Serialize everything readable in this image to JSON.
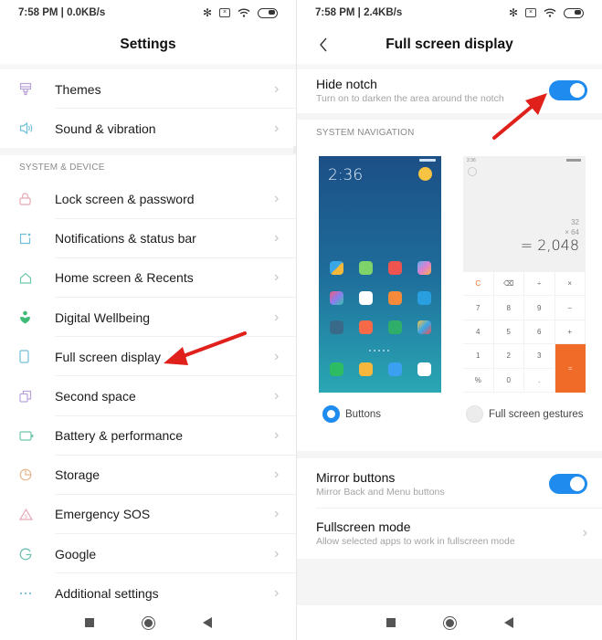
{
  "left": {
    "status": {
      "time_speed": "7:58 PM | 0.0KB/s",
      "icons": [
        "bluetooth-icon",
        "sim-icon",
        "wifi-icon",
        "battery-icon"
      ]
    },
    "title": "Settings",
    "items_top": [
      {
        "label": "Themes",
        "icon": "themes-icon",
        "icon_color": "#b9a3d9"
      },
      {
        "label": "Sound & vibration",
        "icon": "speaker-icon",
        "icon_color": "#6fbfd9"
      }
    ],
    "section_header": "SYSTEM & DEVICE",
    "items": [
      {
        "label": "Lock screen & password",
        "icon": "lock-icon",
        "icon_color": "#e7a7b2"
      },
      {
        "label": "Notifications & status bar",
        "icon": "notification-icon",
        "icon_color": "#6fbfd9"
      },
      {
        "label": "Home screen & Recents",
        "icon": "home-icon",
        "icon_color": "#6fc9a8"
      },
      {
        "label": "Digital Wellbeing",
        "icon": "wellbeing-icon",
        "icon_color": "#3dbb76"
      },
      {
        "label": "Full screen display",
        "icon": "phone-icon",
        "icon_color": "#6fbfd9"
      },
      {
        "label": "Second space",
        "icon": "second-space-icon",
        "icon_color": "#b9a3d9"
      },
      {
        "label": "Battery & performance",
        "icon": "battery-perf-icon",
        "icon_color": "#6fc9a8"
      },
      {
        "label": "Storage",
        "icon": "storage-icon",
        "icon_color": "#e6b88c"
      },
      {
        "label": "Emergency SOS",
        "icon": "sos-icon",
        "icon_color": "#e7a7b2"
      },
      {
        "label": "Google",
        "icon": "google-icon",
        "icon_color": "#6fbfb0"
      },
      {
        "label": "Additional settings",
        "icon": "more-icon",
        "icon_color": "#6fbfd9"
      }
    ],
    "chevron": "›"
  },
  "right": {
    "status": {
      "time_speed": "7:58 PM | 2.4KB/s"
    },
    "title": "Full screen display",
    "hide_notch": {
      "title": "Hide notch",
      "subtitle": "Turn on to darken the area around the notch",
      "enabled": true
    },
    "section_header": "SYSTEM NAVIGATION",
    "home_preview": {
      "clock": "2:36"
    },
    "calc_preview": {
      "time": "2:36",
      "operand1": "32",
      "operand2": "× 64",
      "result": "= 2,048",
      "keys": [
        "C",
        "⌫",
        "÷",
        "×",
        "7",
        "8",
        "9",
        "−",
        "4",
        "5",
        "6",
        "+",
        "1",
        "2",
        "3",
        "%",
        "0",
        ".",
        "="
      ]
    },
    "nav_options": [
      {
        "label": "Buttons",
        "selected": true
      },
      {
        "label": "Full screen gestures",
        "selected": false
      }
    ],
    "mirror_buttons": {
      "title": "Mirror buttons",
      "subtitle": "Mirror Back and Menu buttons",
      "enabled": true
    },
    "fullscreen_mode": {
      "title": "Fullscreen mode",
      "subtitle": "Allow selected apps to work in fullscreen mode"
    },
    "chevron": "›"
  },
  "annotation_color": "#e0201b",
  "accent_color": "#1f8bef"
}
